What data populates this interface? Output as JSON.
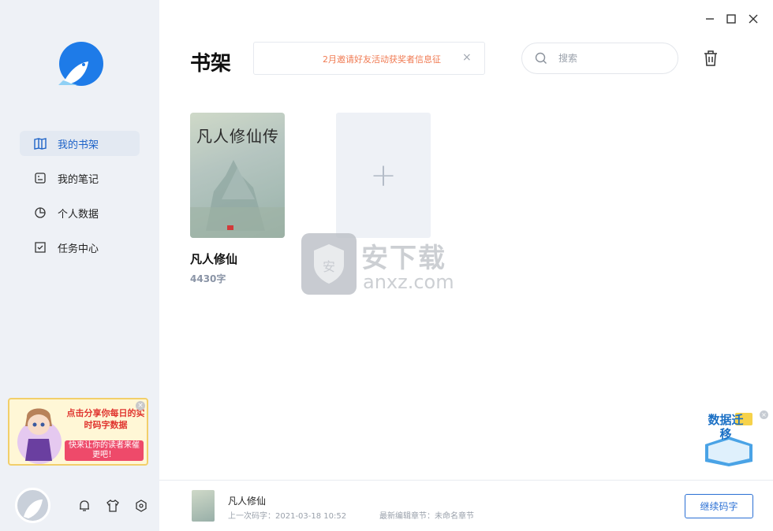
{
  "sidebar": {
    "items": [
      {
        "label": "我的书架",
        "icon": "bookshelf-icon",
        "active": true
      },
      {
        "label": "我的笔记",
        "icon": "note-icon",
        "active": false
      },
      {
        "label": "个人数据",
        "icon": "pie-chart-icon",
        "active": false
      },
      {
        "label": "任务中心",
        "icon": "task-icon",
        "active": false
      }
    ],
    "promo": {
      "line1": "点击分享你每日的实时码字数据",
      "line2": "快来让你的读者来催更吧！"
    },
    "bottom_icons": [
      "bell-icon",
      "shirt-icon",
      "settings-icon"
    ]
  },
  "header": {
    "title": "书架",
    "banner_text": "2月邀请好友活动获奖者信息征",
    "banner_close": "×",
    "search_placeholder": "搜索"
  },
  "books": [
    {
      "title": "凡人修仙",
      "words": "4430字",
      "cover_text": "凡人修仙传"
    }
  ],
  "add_book_symbol": "+",
  "watermark": {
    "text": "安下载",
    "sub": "anxz.com"
  },
  "migrate_badge": {
    "text": "数据迁移"
  },
  "bottom_bar": {
    "book_title": "凡人修仙",
    "last_typed": "上一次码字：2021-03-18 10:52",
    "latest_chapter": "最新编辑章节：未命名章节",
    "continue_label": "继续码字"
  },
  "colors": {
    "accent": "#1e63c8",
    "banner_text": "#f07a52",
    "sidebar_bg": "#eef1f6"
  }
}
